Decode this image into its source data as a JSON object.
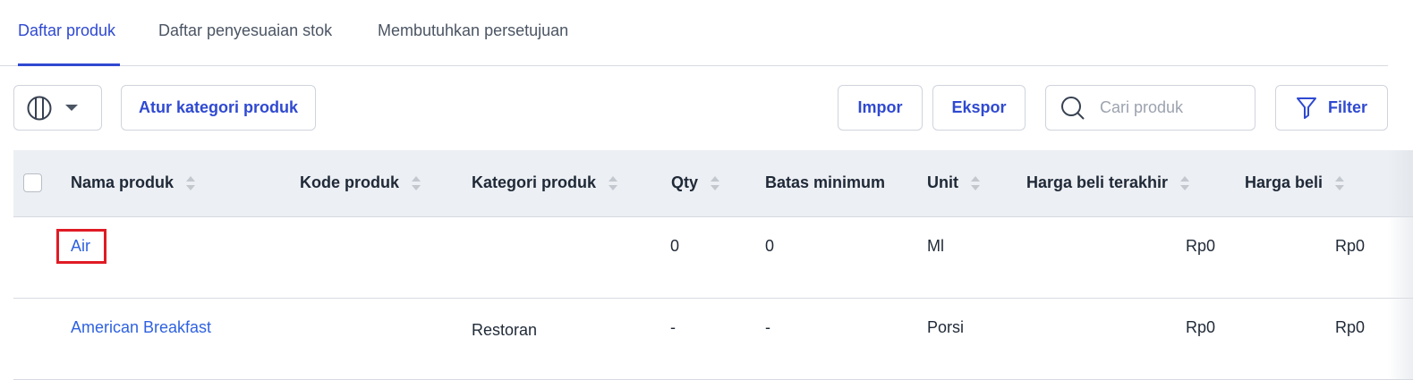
{
  "tabs": [
    {
      "label": "Daftar produk",
      "active": true
    },
    {
      "label": "Daftar penyesuaian stok",
      "active": false
    },
    {
      "label": "Membutuhkan persetujuan",
      "active": false
    }
  ],
  "toolbar": {
    "columns_icon": "columns-icon",
    "category_button": "Atur kategori produk",
    "import_button": "Impor",
    "export_button": "Ekspor",
    "search_placeholder": "Cari produk",
    "filter_button": "Filter"
  },
  "table": {
    "headers": [
      "Nama produk",
      "Kode produk",
      "Kategori produk",
      "Qty",
      "Batas minimum",
      "Unit",
      "Harga beli terakhir",
      "Harga beli"
    ],
    "rows": [
      {
        "name": "Air",
        "code": "",
        "category": "",
        "qty": "0",
        "min": "0",
        "unit": "Ml",
        "last_price": "Rp0",
        "price": "Rp0"
      },
      {
        "name": "American Breakfast",
        "code": "",
        "category": "Restoran",
        "qty": "-",
        "min": "-",
        "unit": "Porsi",
        "last_price": "Rp0",
        "price": "Rp0"
      }
    ]
  },
  "colors": {
    "accent": "#2f49d1",
    "link": "#2f62e0",
    "header_bg": "#eceff3",
    "highlight": "#e01b24"
  }
}
